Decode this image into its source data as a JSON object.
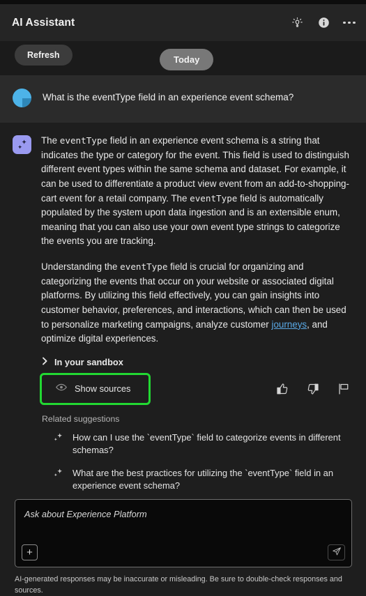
{
  "header": {
    "title": "AI Assistant",
    "icons": [
      {
        "name": "lightbulb-icon",
        "label": "Tips"
      },
      {
        "name": "info-icon",
        "label": "Information"
      },
      {
        "name": "more-options-icon",
        "label": "More options"
      }
    ]
  },
  "toolbar": {
    "refresh_label": "Refresh",
    "today_label": "Today"
  },
  "conversation": {
    "user": {
      "avatar": "user-avatar-icon",
      "message": "What is the eventType field in an experience event schema?"
    },
    "assistant": {
      "avatar": "ai-sparkle-icon",
      "paragraph1": {
        "s1": "The ",
        "code1": "eventType",
        "s2": " field in an experience event schema is a string that indicates the type or category for the event. This field is used to distinguish different event types within the same schema and dataset. For example, it can be used to differentiate a product view event from an add-to-shopping-cart event for a retail company. The ",
        "code2": "eventType",
        "s3": " field is automatically populated by the system upon data ingestion and is an extensible enum, meaning that you can also use your own event type strings to categorize the events you are tracking."
      },
      "paragraph2": {
        "s1": "Understanding the ",
        "code1": "eventType",
        "s2": " field is crucial for organizing and categorizing the events that occur on your website or associated digital platforms. By utilizing this field effectively, you can gain insights into customer behavior, preferences, and interactions, which can then be used to personalize marketing campaigns, analyze customer ",
        "link": "journeys",
        "s3": ", and optimize digital experiences."
      }
    }
  },
  "sandbox": {
    "label": "In your sandbox",
    "expanded": false
  },
  "sources": {
    "show_label": "Show sources",
    "highlight_color": "#22d832"
  },
  "feedback": {
    "thumbs_up": "thumbs-up-icon",
    "thumbs_down": "thumbs-down-icon",
    "flag": "flag-icon"
  },
  "related_suggestions": {
    "title": "Related suggestions",
    "items": [
      {
        "text": "How can I use the `eventType` field to categorize events in different schemas?"
      },
      {
        "text": "What are the best practices for utilizing the `eventType` field in an experience event schema?"
      }
    ]
  },
  "composer": {
    "placeholder": "Ask about Experience Platform",
    "value": "",
    "attach_label": "+",
    "send_label": "send-icon"
  },
  "footer": {
    "disclaimer": "AI-generated responses may be inaccurate or misleading. Be sure to double-check responses and sources."
  },
  "colors": {
    "app_background": "#1e1e1e",
    "header_background": "#252525",
    "user_block_background": "#2b2b2b",
    "accent_link": "#5aa9e6",
    "highlight_green": "#22d832",
    "ai_avatar": "#9a9af0",
    "user_avatar": "#4db3e8"
  }
}
